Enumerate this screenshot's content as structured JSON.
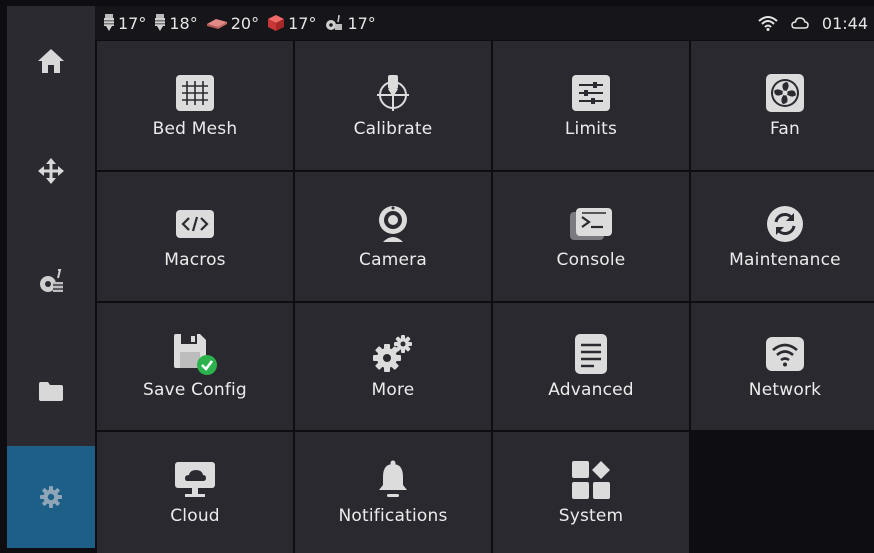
{
  "topbar": {
    "temps": [
      {
        "icon": "extruder-icon",
        "value": "17°"
      },
      {
        "icon": "extruder-icon",
        "value": "18°"
      },
      {
        "icon": "heater-bed-icon",
        "value": "20°"
      },
      {
        "icon": "chamber-icon",
        "value": "17°"
      },
      {
        "icon": "mcu-icon",
        "value": "17°"
      }
    ],
    "time": "01:44"
  },
  "sidebar": {
    "items": [
      {
        "name": "home",
        "icon": "home-icon"
      },
      {
        "name": "move",
        "icon": "move-icon"
      },
      {
        "name": "extrude",
        "icon": "extruder-icon"
      },
      {
        "name": "files",
        "icon": "folder-icon"
      },
      {
        "name": "settings",
        "icon": "gear-icon",
        "active": true
      }
    ]
  },
  "menu": {
    "items": [
      {
        "label": "Bed Mesh",
        "icon": "bed-mesh-icon"
      },
      {
        "label": "Calibrate",
        "icon": "calibrate-icon"
      },
      {
        "label": "Limits",
        "icon": "limits-icon"
      },
      {
        "label": "Fan",
        "icon": "fan-icon"
      },
      {
        "label": "Macros",
        "icon": "code-icon"
      },
      {
        "label": "Camera",
        "icon": "camera-icon"
      },
      {
        "label": "Console",
        "icon": "console-icon"
      },
      {
        "label": "Maintenance",
        "icon": "refresh-icon"
      },
      {
        "label": "Save Config",
        "icon": "save-icon"
      },
      {
        "label": "More",
        "icon": "gears-icon"
      },
      {
        "label": "Advanced",
        "icon": "document-icon"
      },
      {
        "label": "Network",
        "icon": "wifi-icon"
      },
      {
        "label": "Cloud",
        "icon": "cloud-icon"
      },
      {
        "label": "Notifications",
        "icon": "bell-icon"
      },
      {
        "label": "System",
        "icon": "apps-icon"
      }
    ]
  },
  "colors": {
    "accent": "#1d5f86",
    "tile": "#29292f",
    "sidebar": "#2a2a30",
    "background": "#0e0e12",
    "check": "#2bb24c"
  }
}
